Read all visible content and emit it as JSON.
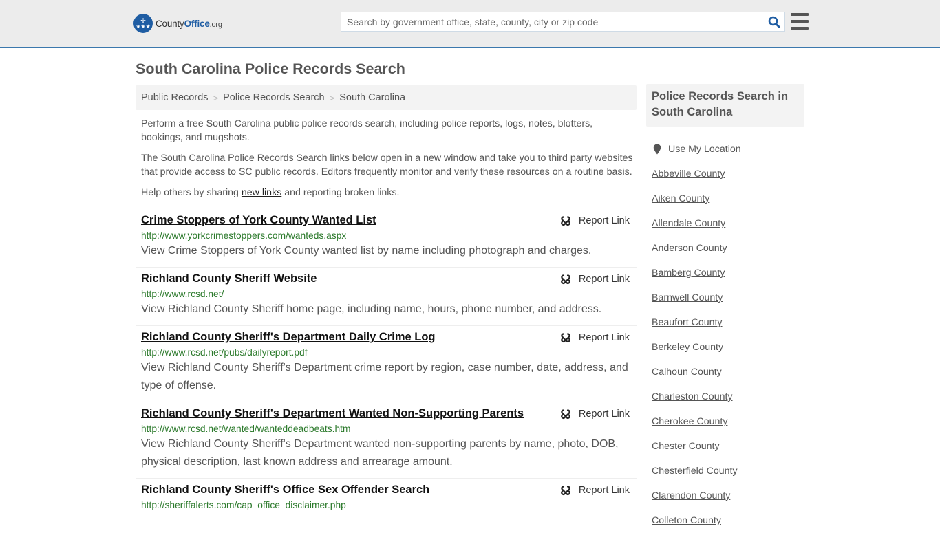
{
  "header": {
    "logo": {
      "name_part1": "County",
      "name_part2": "Office",
      "name_part3": ".org",
      "icon": "eagle-stars-badge-icon"
    },
    "search": {
      "placeholder": "Search by government office, state, county, city or zip code",
      "value": "",
      "icon": "search-icon"
    },
    "menu_icon": "hamburger-menu-icon"
  },
  "page": {
    "title": "South Carolina Police Records Search",
    "breadcrumb": [
      "Public Records",
      "Police Records Search",
      "South Carolina"
    ],
    "breadcrumb_separator": ">",
    "intro": {
      "p1": "Perform a free South Carolina public police records search, including police reports, logs, notes, blotters, bookings, and mugshots.",
      "p2": "The South Carolina Police Records Search links below open in a new window and take you to third party websites that provide access to SC public records. Editors frequently monitor and verify these resources on a routine basis.",
      "p3_before": "Help others by sharing ",
      "p3_link": "new links",
      "p3_after": " and reporting broken links."
    }
  },
  "results": [
    {
      "title": "Crime Stoppers of York County Wanted List",
      "url": "http://www.yorkcrimestoppers.com/wanteds.aspx",
      "description": "View Crime Stoppers of York County wanted list by name including photograph and charges.",
      "report_label": "Report Link"
    },
    {
      "title": "Richland County Sheriff Website",
      "url": "http://www.rcsd.net/",
      "description": "View Richland County Sheriff home page, including name, hours, phone number, and address.",
      "report_label": "Report Link"
    },
    {
      "title": "Richland County Sheriff's Department Daily Crime Log",
      "url": "http://www.rcsd.net/pubs/dailyreport.pdf",
      "description": "View Richland County Sheriff's Department crime report by region, case number, date, address, and type of offense.",
      "report_label": "Report Link"
    },
    {
      "title": "Richland County Sheriff's Department Wanted Non-Supporting Parents",
      "url": "http://www.rcsd.net/wanted/wanteddeadbeats.htm",
      "description": "View Richland County Sheriff's Department wanted non-supporting parents by name, photo, DOB, physical description, last known address and arrearage amount.",
      "report_label": "Report Link"
    },
    {
      "title": "Richland County Sheriff's Office Sex Offender Search",
      "url": "http://sheriffalerts.com/cap_office_disclaimer.php",
      "description": "",
      "report_label": "Report Link"
    }
  ],
  "sidebar": {
    "heading": "Police Records Search in South Carolina",
    "use_location": "Use My Location",
    "counties": [
      "Abbeville County",
      "Aiken County",
      "Allendale County",
      "Anderson County",
      "Bamberg County",
      "Barnwell County",
      "Beaufort County",
      "Berkeley County",
      "Calhoun County",
      "Charleston County",
      "Cherokee County",
      "Chester County",
      "Chesterfield County",
      "Clarendon County",
      "Colleton County"
    ]
  },
  "colors": {
    "brand_blue": "#1f5da3",
    "header_bg": "#ececec",
    "header_border": "#3b78ad",
    "url_green": "#2c7a2c"
  }
}
